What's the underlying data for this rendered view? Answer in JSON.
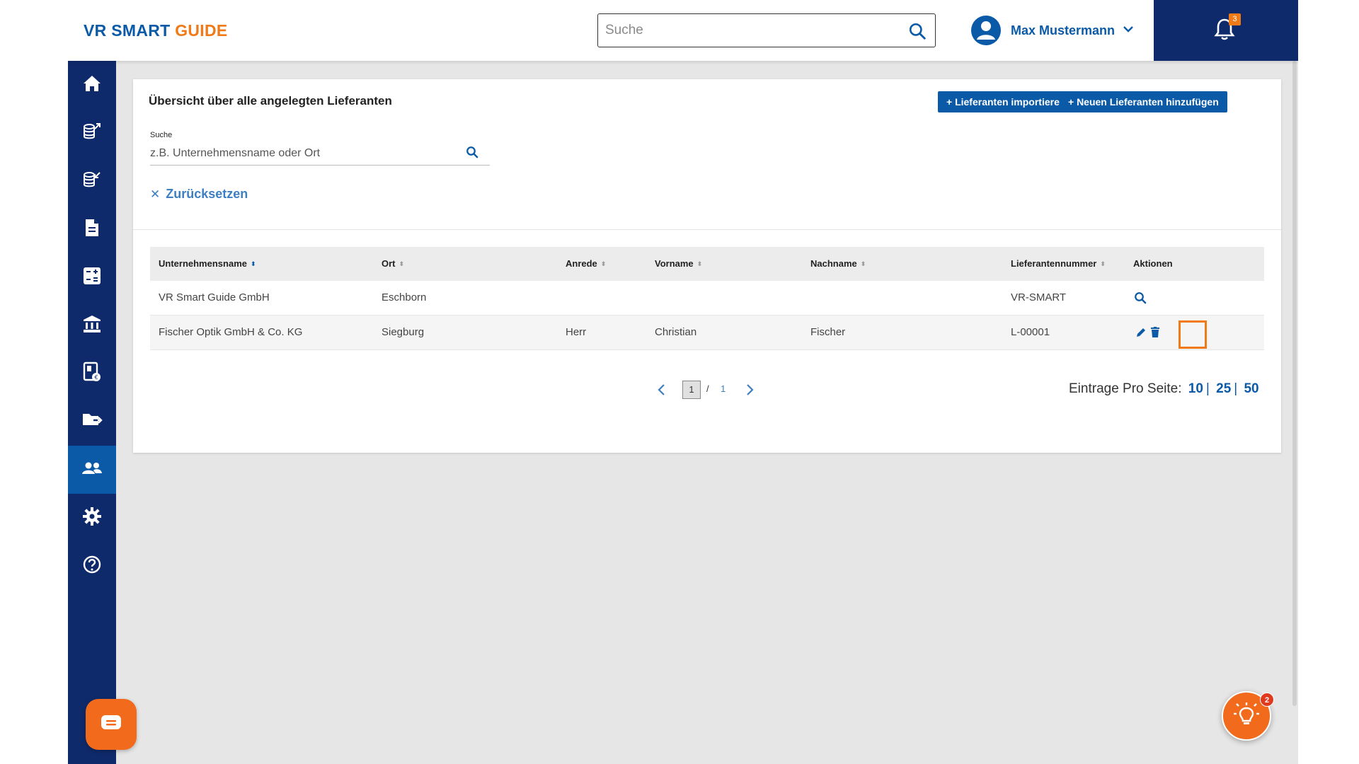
{
  "app": {
    "logo_main": "VR SMART ",
    "logo_accent": "GUIDE"
  },
  "header": {
    "search_placeholder": "Suche",
    "user_name": "Max Mustermann",
    "notification_count": "3"
  },
  "sidebar": {
    "items": [
      {
        "icon": "home-icon"
      },
      {
        "icon": "outgoing-invoices-icon"
      },
      {
        "icon": "incoming-invoices-icon"
      },
      {
        "icon": "document-icon"
      },
      {
        "icon": "calculator-icon"
      },
      {
        "icon": "bank-icon"
      },
      {
        "icon": "receipts-icon"
      },
      {
        "icon": "folder-export-icon"
      },
      {
        "icon": "users-icon",
        "active": true
      },
      {
        "icon": "gear-icon"
      },
      {
        "icon": "help-icon"
      }
    ]
  },
  "main": {
    "title": "Übersicht über alle angelegten Lieferanten",
    "import_button": "+ Lieferanten importieren",
    "add_button": "+ Neuen Lieferanten hinzufügen",
    "search_label": "Suche",
    "search_placeholder": "z.B. Unternehmensname oder Ort",
    "reset_label": "Zurücksetzen"
  },
  "table": {
    "columns": [
      {
        "label": "Unternehmensname",
        "sortable": true,
        "sorted": true
      },
      {
        "label": "Ort",
        "sortable": true
      },
      {
        "label": "Anrede",
        "sortable": true
      },
      {
        "label": "Vorname",
        "sortable": true
      },
      {
        "label": "Nachname",
        "sortable": true
      },
      {
        "label": "Lieferantennummer",
        "sortable": true
      },
      {
        "label": "Aktionen",
        "sortable": false
      }
    ],
    "rows": [
      {
        "company": "VR Smart Guide GmbH",
        "city": "Eschborn",
        "salutation": "",
        "first_name": "",
        "last_name": "",
        "supplier_number": "VR-SMART",
        "actions": [
          "view-icon"
        ]
      },
      {
        "company": "Fischer Optik GmbH & Co. KG",
        "city": "Siegburg",
        "salutation": "Herr",
        "first_name": "Christian",
        "last_name": "Fischer",
        "supplier_number": "L-00001",
        "actions": [
          "edit-icon",
          "delete-icon"
        ]
      }
    ]
  },
  "pagination": {
    "current_page": "1",
    "separator": "/",
    "total_pages": "1",
    "per_page_label": "Eintrage Pro Seite:",
    "per_page_options": [
      "10",
      "25",
      "50"
    ],
    "per_page_sep": "|"
  },
  "floating": {
    "tips_badge": "2"
  },
  "colors": {
    "primary": "#0a5aa8",
    "navy": "#0f2a6b",
    "accent": "#f07a18",
    "chat_orange": "#f26a1b"
  }
}
